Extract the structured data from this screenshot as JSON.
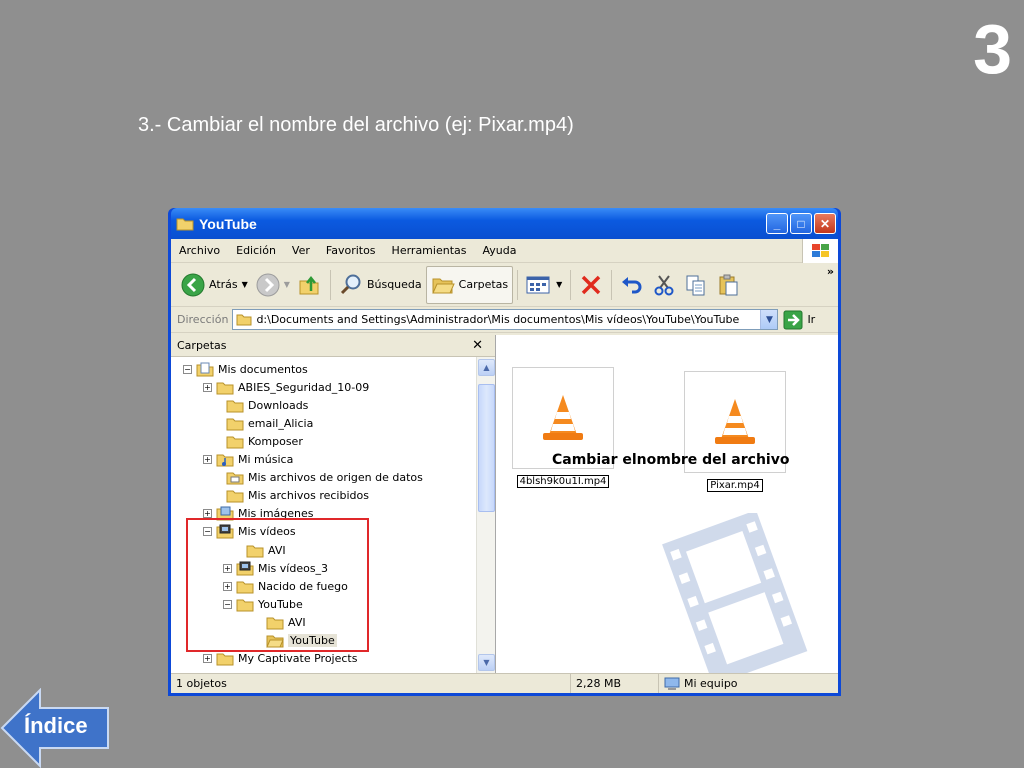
{
  "slide": {
    "number": "3",
    "title": "3.- Cambiar el nombre del archivo (ej: Pixar.mp4)",
    "index_label": "Índice"
  },
  "window": {
    "title": "YouTube",
    "menu": [
      "Archivo",
      "Edición",
      "Ver",
      "Favoritos",
      "Herramientas",
      "Ayuda"
    ],
    "toolbar": {
      "back": "Atrás",
      "search": "Búsqueda",
      "folders": "Carpetas",
      "more": "»"
    },
    "address": {
      "label": "Dirección",
      "path": "d:\\Documents and Settings\\Administrador\\Mis documentos\\Mis vídeos\\YouTube\\YouTube",
      "go": "Ir"
    },
    "folders_pane": {
      "title": "Carpetas",
      "tree": [
        {
          "label": "Mis documentos",
          "pm": "−",
          "icon": "documents-icon"
        },
        {
          "label": "ABIES_Seguridad_10-09",
          "pm": "+",
          "icon": "folder-icon"
        },
        {
          "label": "Downloads",
          "pm": "",
          "icon": "folder-icon"
        },
        {
          "label": "email_Alicia",
          "pm": "",
          "icon": "folder-icon"
        },
        {
          "label": "Komposer",
          "pm": "",
          "icon": "folder-icon"
        },
        {
          "label": "Mi música",
          "pm": "+",
          "icon": "music-folder-icon"
        },
        {
          "label": "Mis archivos de origen de datos",
          "pm": "",
          "icon": "data-folder-icon"
        },
        {
          "label": "Mis archivos recibidos",
          "pm": "",
          "icon": "folder-icon"
        },
        {
          "label": "Mis imágenes",
          "pm": "+",
          "icon": "pictures-folder-icon"
        },
        {
          "label": "Mis vídeos",
          "pm": "−",
          "icon": "video-folder-icon"
        },
        {
          "label": "AVI",
          "pm": "",
          "icon": "folder-icon"
        },
        {
          "label": "Mis vídeos_3",
          "pm": "+",
          "icon": "video-folder-icon"
        },
        {
          "label": "Nacido de fuego",
          "pm": "+",
          "icon": "folder-icon"
        },
        {
          "label": "YouTube",
          "pm": "−",
          "icon": "folder-icon"
        },
        {
          "label": "AVI",
          "pm": "",
          "icon": "folder-icon"
        },
        {
          "label": "YouTube",
          "pm": "",
          "icon": "open-folder-icon"
        },
        {
          "label": "My Captivate Projects",
          "pm": "+",
          "icon": "folder-icon"
        }
      ]
    },
    "files": [
      {
        "name": "4blsh9k0u1I.mp4",
        "icon": "vlc-cone-icon"
      },
      {
        "name": "Pixar.mp4",
        "icon": "vlc-cone-icon"
      }
    ],
    "annotation": "Cambiar elnombre del archivo",
    "status": {
      "objects": "1 objetos",
      "size": "2,28 MB",
      "location": "Mi equipo"
    }
  }
}
